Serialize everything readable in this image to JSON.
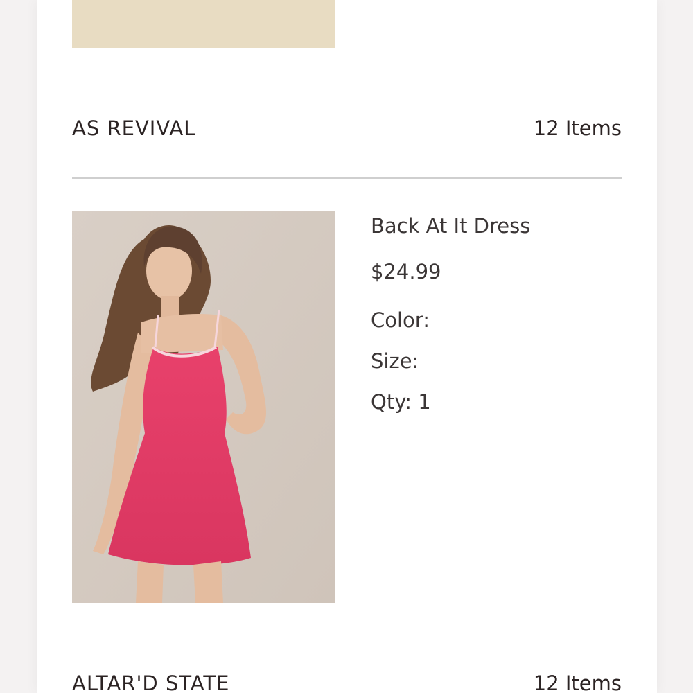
{
  "groups": [
    {
      "brand": "AS REVIVAL",
      "count": "12 Items",
      "product": {
        "name": "Back At It Dress",
        "price": "$24.99",
        "color_label": "Color:",
        "color_value": "",
        "size_label": "Size:",
        "size_value": "",
        "qty_label": "Qty:",
        "qty_value": "1",
        "image_icon": "product-photo-pink-dress"
      }
    },
    {
      "brand": "ALTAR'D STATE",
      "count": "12 Items"
    }
  ],
  "colors": {
    "background": "#f4f2f2",
    "card": "#ffffff",
    "previous_thumb": "#e8dcc2",
    "dress": "#e8416b",
    "text": "#2b2323"
  }
}
